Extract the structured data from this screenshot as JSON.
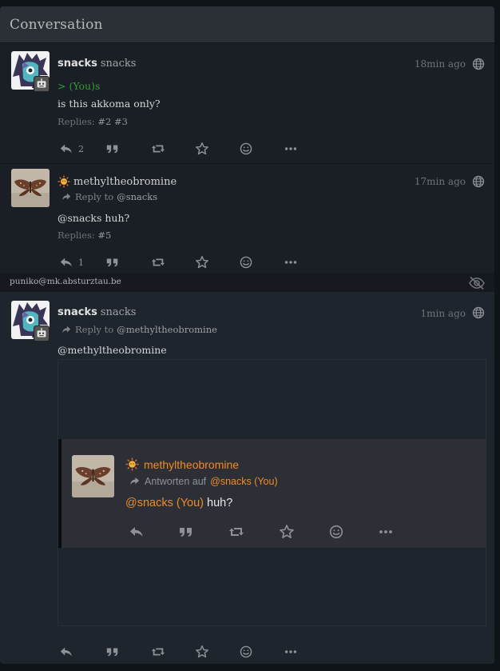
{
  "panel": {
    "title": "Conversation"
  },
  "posts": [
    {
      "display_name": "snacks",
      "acct": "snacks",
      "time": "18min ago",
      "greentext": "> (You)s",
      "text": "is this akkoma only?",
      "replies_label": "Replies:",
      "replies": [
        "#2",
        "#3"
      ],
      "reply_count": "2"
    },
    {
      "display_name": "methyltheobromine",
      "reply_label": "Reply to",
      "reply_to": "@snacks",
      "time": "17min ago",
      "text": "@snacks huh?",
      "replies_label": "Replies:",
      "replies": [
        "#5"
      ],
      "reply_count": "1"
    },
    {
      "display_name": "snacks",
      "acct": "snacks",
      "reply_label": "Reply to",
      "reply_to": "@methyltheobromine",
      "time": "1min ago",
      "text": "@methyltheobromine"
    }
  ],
  "separator": {
    "text": "puniko@mk.absturztau.be"
  },
  "embed": {
    "display_name": "methyltheobromine",
    "reply_label": "Antworten auf",
    "reply_to": "@snacks (You)",
    "mention": "@snacks (You)",
    "text": " huh?"
  },
  "icons": {
    "reply": "reply-icon",
    "quote": "quote-icon",
    "repeat": "retweet-icon",
    "favorite": "star-icon",
    "react": "smiley-icon",
    "more": "more-dots-icon",
    "visibility": "globe-icon",
    "hidden": "eye-slash-icon"
  },
  "colors": {
    "accent": "#f28b1f",
    "greentext": "#2ea02e",
    "background": "#1a1f26",
    "header": "#2b3036"
  }
}
